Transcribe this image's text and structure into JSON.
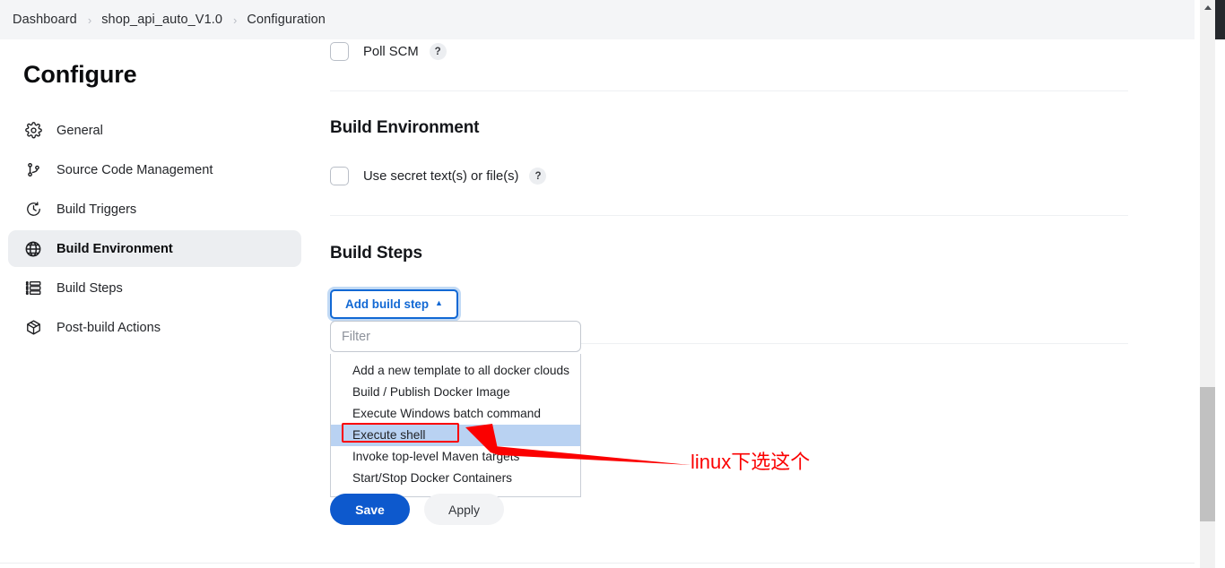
{
  "breadcrumb": {
    "separator": "›",
    "items": [
      {
        "label": "Dashboard"
      },
      {
        "label": "shop_api_auto_V1.0"
      },
      {
        "label": "Configuration"
      }
    ]
  },
  "sidebar": {
    "title": "Configure",
    "items": [
      {
        "label": "General",
        "icon": "gear-icon",
        "active": false
      },
      {
        "label": "Source Code Management",
        "icon": "git-branch-icon",
        "active": false
      },
      {
        "label": "Build Triggers",
        "icon": "clock-icon",
        "active": false
      },
      {
        "label": "Build Environment",
        "icon": "globe-icon",
        "active": true
      },
      {
        "label": "Build Steps",
        "icon": "list-icon",
        "active": false
      },
      {
        "label": "Post-build Actions",
        "icon": "package-icon",
        "active": false
      }
    ]
  },
  "main": {
    "poll_scm": {
      "label": "Poll SCM",
      "checked": false,
      "help": "?"
    },
    "build_environment": {
      "heading": "Build Environment",
      "secret_text": {
        "label": "Use secret text(s) or file(s)",
        "checked": false,
        "help": "?"
      }
    },
    "build_steps": {
      "heading": "Build Steps",
      "add_button_label": "Add build step",
      "add_button_caret": "▲",
      "filter_placeholder": "Filter",
      "filter_value": "",
      "options": [
        {
          "label": "Add a new template to all docker clouds",
          "highlighted": false
        },
        {
          "label": "Build / Publish Docker Image",
          "highlighted": false
        },
        {
          "label": "Execute Windows batch command",
          "highlighted": false
        },
        {
          "label": "Execute shell",
          "highlighted": true
        },
        {
          "label": "Invoke top-level Maven targets",
          "highlighted": false
        },
        {
          "label": "Start/Stop Docker Containers",
          "highlighted": false
        }
      ]
    },
    "footer": {
      "save_label": "Save",
      "apply_label": "Apply"
    }
  },
  "annotation": {
    "text": "linux下选这个",
    "color": "#fb0000"
  },
  "colors": {
    "accent_blue": "#0d59cd",
    "link_blue": "#1168d4",
    "highlight_blue": "#b9d2f2",
    "bar_background": "#f4f5f7",
    "active_nav": "#eceef1",
    "annotation_red": "#fb0000"
  }
}
